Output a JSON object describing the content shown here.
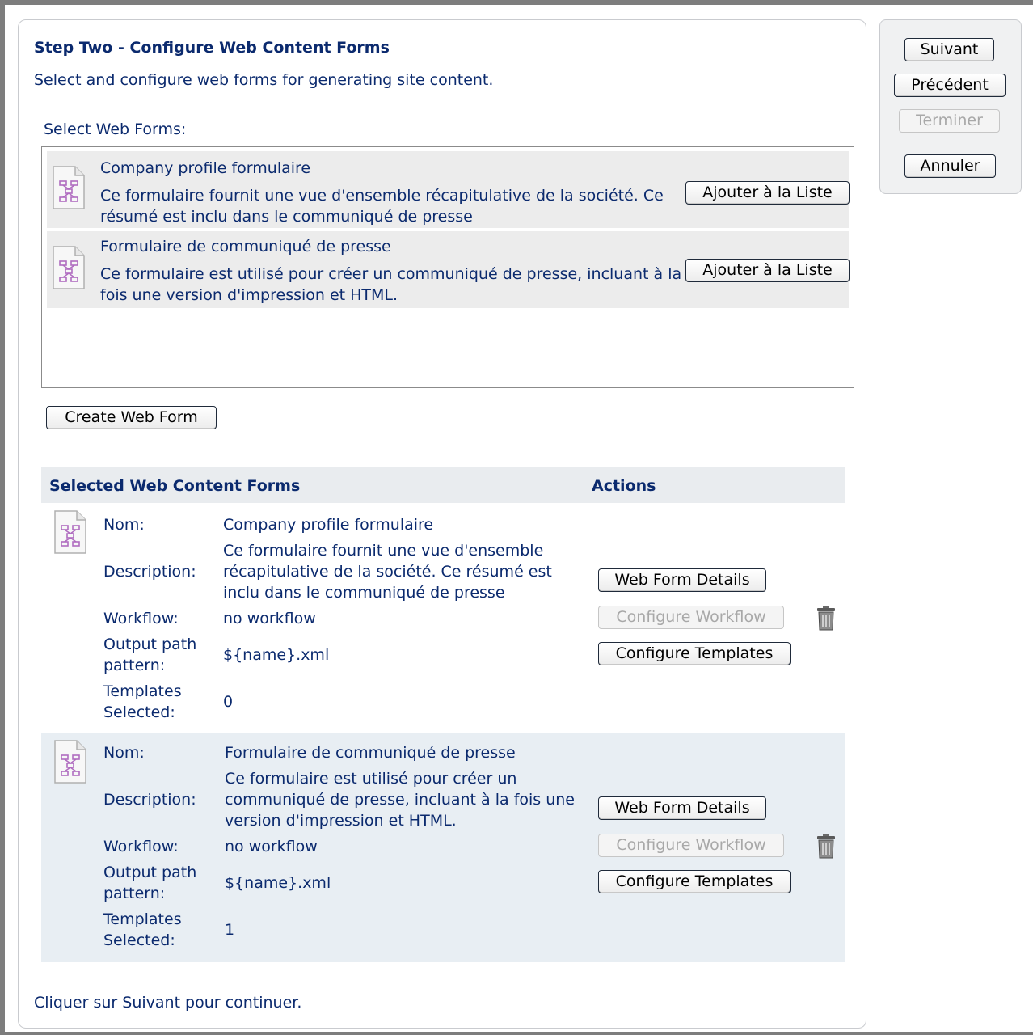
{
  "wizard": {
    "title": "Step Two - Configure Web Content Forms",
    "subtitle": "Select and configure web forms for generating site content.",
    "select_label": "Select Web Forms:",
    "footer": "Cliquer sur Suivant pour continuer."
  },
  "nav_buttons": {
    "next": "Suivant",
    "previous": "Précédent",
    "finish": "Terminer",
    "cancel": "Annuler"
  },
  "available_forms": [
    {
      "name": "Company profile formulaire",
      "description_line1": "Ce formulaire fournit une vue d'ensemble récapitulative de la société. Ce",
      "description_line2": "résumé est inclu dans le communiqué de presse",
      "add_label": "Ajouter à la Liste",
      "icon": "web-form-document-icon"
    },
    {
      "name": "Formulaire de communiqué de presse",
      "description_line1": "Ce formulaire est utilisé pour créer un communiqué de presse, incluant à la",
      "description_line2": "fois une version d'impression et HTML.",
      "add_label": "Ajouter à la Liste",
      "icon": "web-form-document-icon"
    }
  ],
  "create_button": "Create Web Form",
  "selected": {
    "header_title": "Selected Web Content Forms",
    "header_actions": "Actions",
    "labels": {
      "name": "Nom:",
      "description": "Description:",
      "workflow": "Workflow:",
      "output_line1": "Output path",
      "output_line2": "pattern:",
      "templates_line1": "Templates",
      "templates_line2": "Selected:"
    },
    "actions": {
      "details": "Web Form Details",
      "workflow": "Configure Workflow",
      "templates": "Configure Templates"
    },
    "rows": [
      {
        "name": "Company profile formulaire",
        "description_line1": "Ce formulaire fournit une vue d'ensemble",
        "description_line2": "récapitulative de la société. Ce résumé est",
        "description_line3": "inclu dans le communiqué de presse",
        "workflow": "no workflow",
        "output_path": "${name}.xml",
        "templates_selected": "0"
      },
      {
        "name": "Formulaire de communiqué de presse",
        "description_line1": "Ce formulaire est utilisé pour créer un",
        "description_line2": "communiqué de presse, incluant à la fois une",
        "description_line3": "version d'impression et HTML.",
        "workflow": "no workflow",
        "output_path": "${name}.xml",
        "templates_selected": "1"
      }
    ]
  },
  "colors": {
    "text": "#0b2a6e",
    "row_alt": "#e8eef3",
    "list_row": "#ececec",
    "panel_bg": "#f0f1f2"
  }
}
